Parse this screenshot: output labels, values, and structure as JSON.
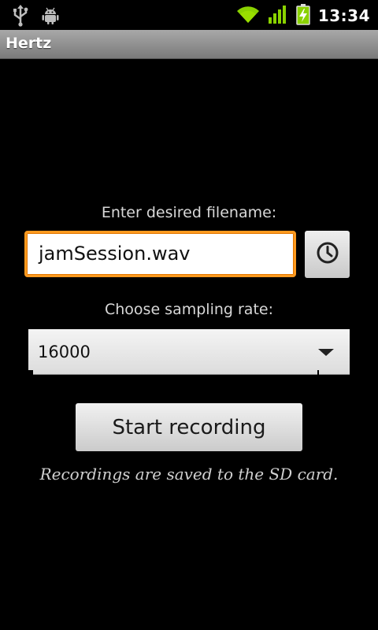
{
  "status_bar": {
    "time": "13:34",
    "icons": [
      "usb-icon",
      "android-debug-icon",
      "wifi-icon",
      "signal-icon",
      "battery-charging-icon"
    ]
  },
  "app": {
    "title": "Hertz"
  },
  "form": {
    "filename_label": "Enter desired filename:",
    "filename_value": "jamSession.wav",
    "timestamp_button_icon": "clock-icon",
    "sampling_label": "Choose sampling rate:",
    "sampling_value": "16000",
    "start_button_label": "Start recording",
    "note": "Recordings are saved to the SD card."
  },
  "colors": {
    "focus_border": "#ff9a1f",
    "title_bar": "#8e8e8e",
    "wifi_signal": "#8ad200"
  }
}
